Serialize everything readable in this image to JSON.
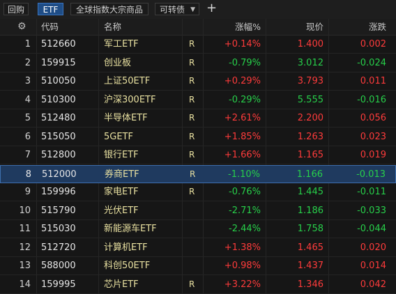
{
  "toolbar": {
    "back_label": "回购",
    "etf_label": "ETF",
    "global_label": "全球指数大宗商品",
    "convertible_label": "可转债",
    "plus_icon": "plus-icon"
  },
  "header": {
    "code": "代码",
    "name": "名称",
    "pct": "涨幅%",
    "price": "现价",
    "change": "涨跌"
  },
  "colors": {
    "up": "#ff3b3b",
    "down": "#27d04a",
    "selected": "#1f3a5f",
    "name": "#e8e0a0"
  },
  "rows": [
    {
      "idx": "1",
      "code": "512660",
      "name": "军工ETF",
      "r": "R",
      "pct": "+0.14%",
      "price": "1.400",
      "chg": "0.002",
      "dir": "up"
    },
    {
      "idx": "2",
      "code": "159915",
      "name": "创业板",
      "r": "R",
      "pct": "-0.79%",
      "price": "3.012",
      "chg": "-0.024",
      "dir": "down"
    },
    {
      "idx": "3",
      "code": "510050",
      "name": "上证50ETF",
      "r": "R",
      "pct": "+0.29%",
      "price": "3.793",
      "chg": "0.011",
      "dir": "up"
    },
    {
      "idx": "4",
      "code": "510300",
      "name": "沪深300ETF",
      "r": "R",
      "pct": "-0.29%",
      "price": "5.555",
      "chg": "-0.016",
      "dir": "down"
    },
    {
      "idx": "5",
      "code": "512480",
      "name": "半导体ETF",
      "r": "R",
      "pct": "+2.61%",
      "price": "2.200",
      "chg": "0.056",
      "dir": "up"
    },
    {
      "idx": "6",
      "code": "515050",
      "name": "5GETF",
      "r": "R",
      "pct": "+1.85%",
      "price": "1.263",
      "chg": "0.023",
      "dir": "up"
    },
    {
      "idx": "7",
      "code": "512800",
      "name": "银行ETF",
      "r": "R",
      "pct": "+1.66%",
      "price": "1.165",
      "chg": "0.019",
      "dir": "up"
    },
    {
      "idx": "8",
      "code": "512000",
      "name": "券商ETF",
      "r": "R",
      "pct": "-1.10%",
      "price": "1.166",
      "chg": "-0.013",
      "dir": "down",
      "selected": true
    },
    {
      "idx": "9",
      "code": "159996",
      "name": "家电ETF",
      "r": "R",
      "pct": "-0.76%",
      "price": "1.445",
      "chg": "-0.011",
      "dir": "down"
    },
    {
      "idx": "10",
      "code": "515790",
      "name": "光伏ETF",
      "r": "",
      "pct": "-2.71%",
      "price": "1.186",
      "chg": "-0.033",
      "dir": "down"
    },
    {
      "idx": "11",
      "code": "515030",
      "name": "新能源车ETF",
      "r": "",
      "pct": "-2.44%",
      "price": "1.758",
      "chg": "-0.044",
      "dir": "down"
    },
    {
      "idx": "12",
      "code": "512720",
      "name": "计算机ETF",
      "r": "",
      "pct": "+1.38%",
      "price": "1.465",
      "chg": "0.020",
      "dir": "up"
    },
    {
      "idx": "13",
      "code": "588000",
      "name": "科创50ETF",
      "r": "",
      "pct": "+0.98%",
      "price": "1.437",
      "chg": "0.014",
      "dir": "up"
    },
    {
      "idx": "14",
      "code": "159995",
      "name": "芯片ETF",
      "r": "R",
      "pct": "+3.22%",
      "price": "1.346",
      "chg": "0.042",
      "dir": "up"
    }
  ]
}
